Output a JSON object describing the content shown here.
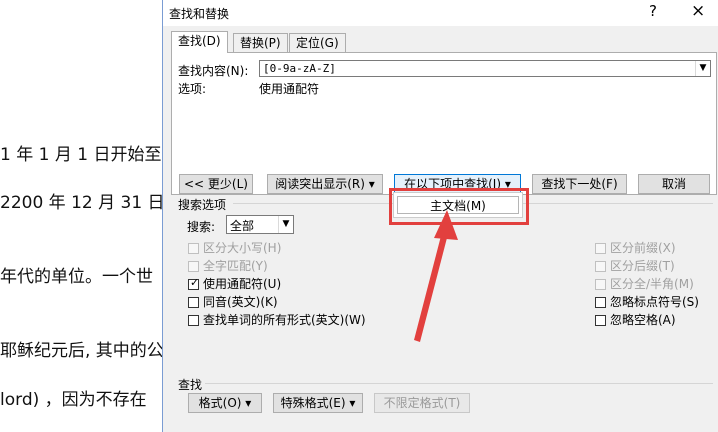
{
  "document": {
    "lines": [
      "1 年 1 月 1 日开始至",
      "2200 年 12 月 31 日",
      "年代的单位。一个世",
      "耶稣纪元后, 其中的公",
      "lord) ，因为不存在"
    ]
  },
  "dialog": {
    "title": "查找和替换",
    "help_label": "?",
    "close_label": "×",
    "tabs": [
      {
        "label": "查找(D)",
        "active": true
      },
      {
        "label": "替换(P)",
        "active": false
      },
      {
        "label": "定位(G)",
        "active": false
      }
    ],
    "find_label": "查找内容(N):",
    "find_value": "[0-9a-zA-Z]",
    "options_label": "选项:",
    "options_value": "使用通配符",
    "buttons": {
      "less": "<< 更少(L)",
      "reading_highlight": "阅读突出显示(R) ▾",
      "find_in": "在以下项中查找(I) ▾",
      "find_next": "查找下一处(F)",
      "cancel": "取消"
    },
    "dropdown_menu": {
      "item": "主文档(M)"
    },
    "search_options_title": "搜索选项",
    "search_label": "搜索:",
    "search_value": "全部",
    "checkboxes_left": [
      {
        "label": "区分大小写(H)",
        "checked": false,
        "enabled": false
      },
      {
        "label": "全字匹配(Y)",
        "checked": false,
        "enabled": false
      },
      {
        "label": "使用通配符(U)",
        "checked": true,
        "enabled": true
      },
      {
        "label": "同音(英文)(K)",
        "checked": false,
        "enabled": true
      },
      {
        "label": "查找单词的所有形式(英文)(W)",
        "checked": false,
        "enabled": true
      }
    ],
    "checkboxes_right": [
      {
        "label": "区分前缀(X)",
        "checked": false,
        "enabled": false
      },
      {
        "label": "区分后缀(T)",
        "checked": false,
        "enabled": false
      },
      {
        "label": "区分全/半角(M)",
        "checked": false,
        "enabled": false
      },
      {
        "label": "忽略标点符号(S)",
        "checked": false,
        "enabled": true
      },
      {
        "label": "忽略空格(A)",
        "checked": false,
        "enabled": true
      }
    ],
    "find_section_title": "查找",
    "bottom_buttons": {
      "format": "格式(O) ▾",
      "special": "特殊格式(E) ▾",
      "no_format": "不限定格式(T)"
    },
    "colors": {
      "annotation_red": "#e2403e",
      "accent": "#0078d7"
    }
  }
}
